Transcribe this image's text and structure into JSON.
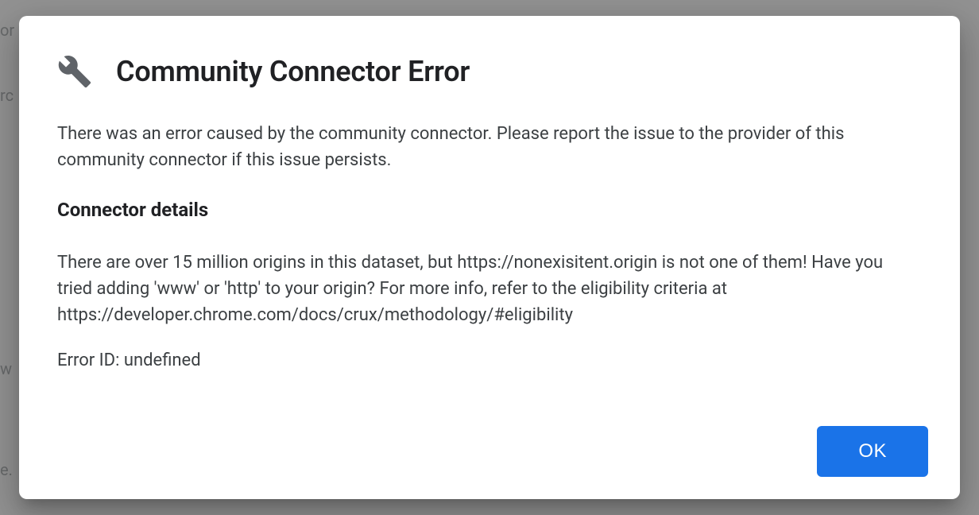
{
  "dialog": {
    "title": "Community Connector Error",
    "intro": "There was an error caused by the community connector. Please report the issue to the provider of this community connector if this issue persists.",
    "details_heading": "Connector details",
    "details_message": "There are over 15 million origins in this dataset, but https://nonexisitent.origin is not one of them! Have you tried adding 'www' or 'http' to your origin? For more info, refer to the eligibility criteria at https://developer.chrome.com/docs/crux/methodology/#eligibility",
    "error_id_line": "Error ID: undefined",
    "ok_label": "OK"
  },
  "background": {
    "t1": "or",
    "t2": "rc",
    "t3": "w",
    "t4": "e."
  }
}
